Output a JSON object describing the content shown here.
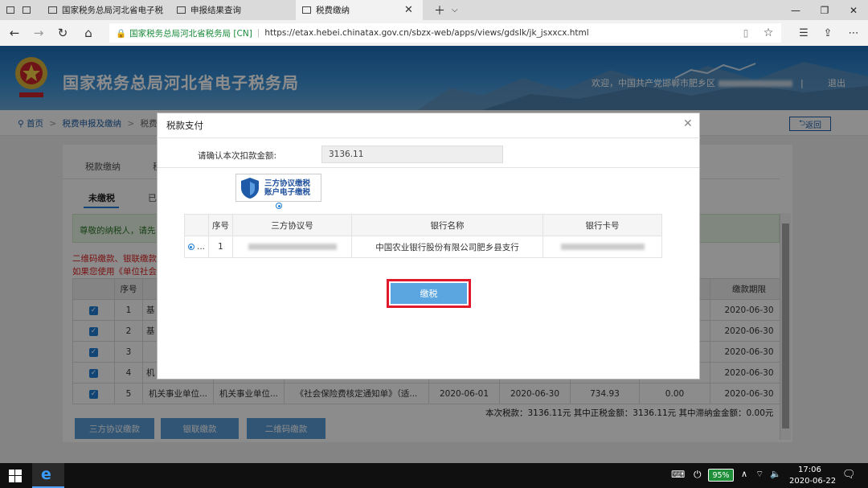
{
  "browser": {
    "tabs": [
      {
        "label": "国家税务总局河北省电子税"
      },
      {
        "label": "申报结果查询"
      },
      {
        "label": "税费缴纳"
      }
    ],
    "url_domain": "国家税务总局河北省税务局 [CN]",
    "url": "https://etax.hebei.chinatax.gov.cn/sbzx-web/apps/views/gdslk/jk_jsxxcx.html"
  },
  "header": {
    "site_title": "国家税务总局河北省电子税务局",
    "welcome": "欢迎，中国共产党邯郸市肥乡区",
    "logout": "退出"
  },
  "breadcrumb": {
    "home": "首页",
    "item1": "税费申报及缴纳",
    "item2": "税费缴",
    "back": "返回"
  },
  "page": {
    "main_tab_1": "税款缴纳",
    "main_tab_2": "税",
    "sub_tab_1": "未缴税",
    "sub_tab_2": "已",
    "notice": "尊敬的纳税人，请先",
    "red_line_1": "二维码缴款、银联缴款",
    "red_line_2": "如果您使用《单位社会",
    "table": {
      "col_seq": "序号",
      "col_deadline": "缴款期限",
      "rows": [
        {
          "seq": "1",
          "c1": "基",
          "deadline": "2020-06-30"
        },
        {
          "seq": "2",
          "c1": "基",
          "deadline": "2020-06-30"
        },
        {
          "seq": "3",
          "c1": "",
          "deadline": "2020-06-30"
        },
        {
          "seq": "4",
          "c1": "机",
          "deadline": "2020-06-30"
        }
      ],
      "last_row": {
        "seq": "5",
        "c1": "机关事业单位...",
        "c2": "机关事业单位...",
        "c3": "《社会保险费核定通知单》（适...",
        "c4": "2020-06-01",
        "c5": "2020-06-30",
        "c6": "734.93",
        "c7": "0.00",
        "deadline": "2020-06-30"
      }
    },
    "summary": "本次税款：3136.11元    其中正税金额：3136.11元    其中滞纳金金额：0.00元",
    "buttons": {
      "sanfang": "三方协议缴款",
      "yinlian": "银联缴款",
      "qrcode": "二维码缴款"
    }
  },
  "modal": {
    "title": "税款支付",
    "confirm_label": "请确认本次扣款金额:",
    "amount": "3136.11",
    "method_line1": "三方协议缴税",
    "method_line2": "账户电子缴税",
    "table": {
      "h_seq": "序号",
      "h_protocol": "三方协议号",
      "h_bank": "银行名称",
      "h_card": "银行卡号",
      "row": {
        "sel": "...",
        "seq": "1",
        "bank": "中国农业银行股份有限公司肥乡县支行"
      }
    },
    "pay_button": "缴税"
  },
  "taskbar": {
    "battery": "95%",
    "time": "17:06",
    "date": "2020-06-22"
  },
  "colors": {
    "accent": "#1f7fd6",
    "highlight_outline": "#e2192d",
    "pay_button": "#5ba6e0"
  }
}
